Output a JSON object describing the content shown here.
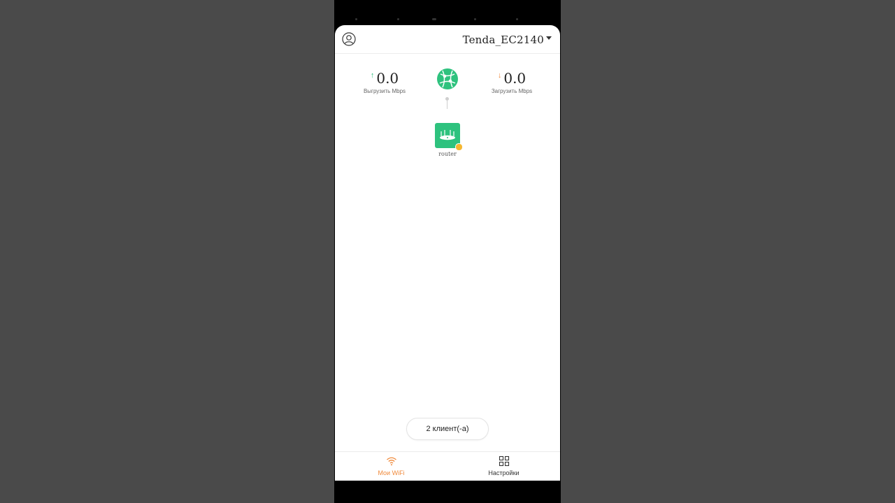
{
  "header": {
    "network_name": "Tenda_EC2140"
  },
  "stats": {
    "upload": {
      "value": "0.0",
      "label": "Выгрузить Mbps"
    },
    "download": {
      "value": "0.0",
      "label": "Загрузить Mbps"
    }
  },
  "topology": {
    "internet_icon": "globe-icon",
    "router_label": "router"
  },
  "clients": {
    "button_label": "2 клиент(-а)"
  },
  "tabbar": {
    "tabs": [
      {
        "label": "Мои WiFi",
        "icon": "wifi-icon",
        "active": true
      },
      {
        "label": "Настройки",
        "icon": "grid-icon",
        "active": false
      }
    ]
  },
  "colors": {
    "accent": "#f08a3c",
    "brand_green": "#2ec27e",
    "upload_arrow": "#2fbf7f",
    "download_arrow": "#f08a3c",
    "badge": "#f5b731"
  }
}
